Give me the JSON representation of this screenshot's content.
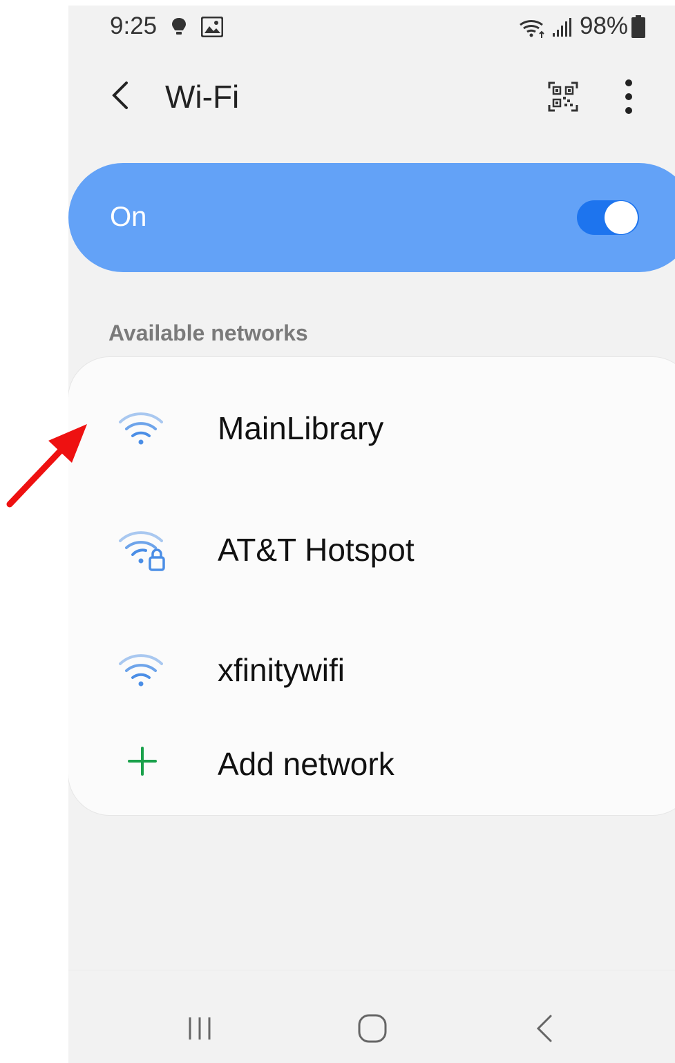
{
  "status_bar": {
    "time": "9:25",
    "battery": "98%",
    "icons": [
      "bulb-icon",
      "image-icon",
      "wifi-signal-icon",
      "cellular-signal-icon",
      "battery-icon"
    ]
  },
  "header": {
    "title": "Wi-Fi",
    "icons": [
      "back-icon",
      "qr-code-icon",
      "more-options-icon"
    ]
  },
  "toggle": {
    "label": "On",
    "state": "on",
    "color": "#63a2f7"
  },
  "networks": {
    "section_label": "Available networks",
    "items": [
      {
        "name": "MainLibrary",
        "icon": "wifi-icon",
        "secured": false
      },
      {
        "name": "AT&T Hotspot",
        "icon": "wifi-lock-icon",
        "secured": true
      },
      {
        "name": "xfinitywifi",
        "icon": "wifi-icon",
        "secured": false
      }
    ],
    "add_label": "Add network",
    "add_color": "#1aa14b"
  },
  "nav": {
    "icons": [
      "recents-icon",
      "home-icon",
      "back-nav-icon"
    ]
  },
  "colors": {
    "accent": "#1d74ee",
    "wifi_icon": "#4b8ee6",
    "annotation_arrow": "#ee1111"
  }
}
